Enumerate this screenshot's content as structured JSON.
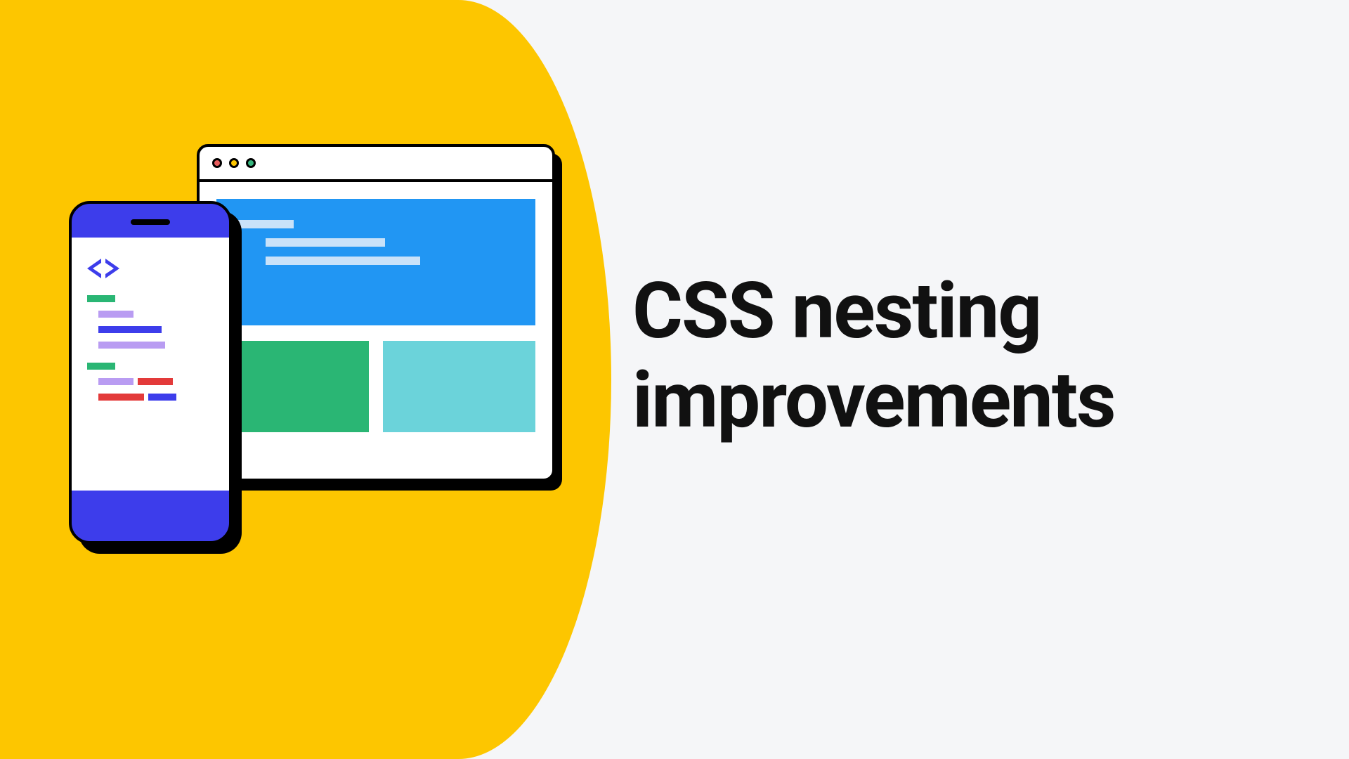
{
  "title": "CSS nesting improvements",
  "colors": {
    "yellow": "#fdc600",
    "blue": "#2196f3",
    "indigo": "#3d3deb",
    "green": "#2ab674",
    "cyan": "#6bd3da",
    "purple": "#b99cf2",
    "red": "#e33a3a",
    "bg": "#f5f6f8"
  }
}
